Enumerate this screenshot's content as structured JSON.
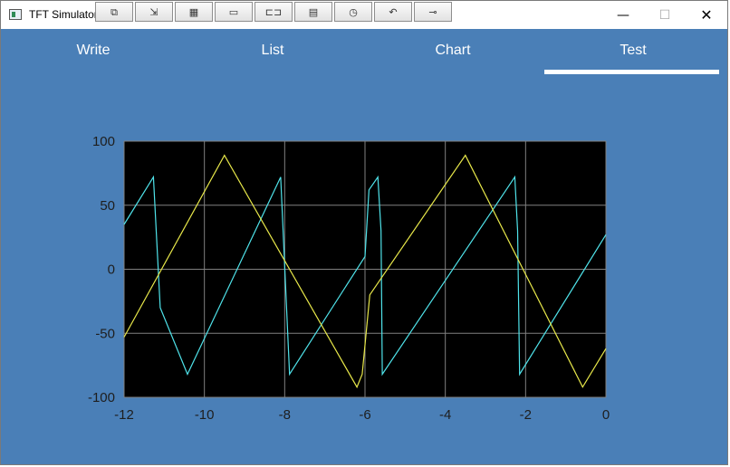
{
  "window": {
    "title": "TFT Simulator",
    "controls": {
      "minimize": "—",
      "maximize": "☐",
      "close": "✕"
    }
  },
  "toolbar": {
    "buttons": [
      {
        "icon": "copy-screen-icon",
        "glyph": "⧉"
      },
      {
        "icon": "import-icon",
        "glyph": "⇲"
      },
      {
        "icon": "grid-icon",
        "glyph": "▦"
      },
      {
        "icon": "window-icon",
        "glyph": "▭"
      },
      {
        "icon": "connector-icon",
        "glyph": "⊏⊐"
      },
      {
        "icon": "keyboard-icon",
        "glyph": "▤"
      },
      {
        "icon": "clock-icon",
        "glyph": "◷"
      },
      {
        "icon": "undo-arrow-icon",
        "glyph": "↶"
      },
      {
        "icon": "plug-icon",
        "glyph": "⊸"
      }
    ]
  },
  "tabs": [
    {
      "label": "Write"
    },
    {
      "label": "List"
    },
    {
      "label": "Chart"
    },
    {
      "label": "Test"
    }
  ],
  "active_tab": "Test",
  "colors": {
    "background": "#4a7fb7",
    "plot_background": "#000000",
    "grid": "#808080",
    "series_cyan": "#4fe3ea",
    "series_yellow": "#e8e84a"
  },
  "chart_data": {
    "type": "line",
    "title": "",
    "xlabel": "",
    "ylabel": "",
    "xlim": [
      -12,
      0
    ],
    "ylim": [
      -100,
      100
    ],
    "xticks": [
      -12,
      -10,
      -8,
      -6,
      -4,
      -2,
      0
    ],
    "yticks": [
      100,
      50,
      0,
      -50,
      -100
    ],
    "grid": true,
    "legend": "none",
    "series": [
      {
        "color": "#4fe3ea",
        "x": [
          -12,
          -11.27,
          -11.1,
          -10.42,
          -8.1,
          -7.88,
          -6.0,
          -5.9,
          -5.68,
          -5.6,
          -5.57,
          -2.27,
          -2.2,
          -2.15,
          0
        ],
        "y": [
          35,
          72,
          -30,
          -82,
          72,
          -82,
          10,
          62,
          72,
          30,
          -82,
          72,
          30,
          -82,
          27
        ]
      },
      {
        "color": "#e8e84a",
        "x": [
          -12,
          -9.5,
          -6.2,
          -6.07,
          -5.88,
          -3.5,
          -0.58,
          0
        ],
        "y": [
          -53,
          89,
          -92,
          -82,
          -20,
          89,
          -92,
          -62
        ]
      }
    ]
  }
}
